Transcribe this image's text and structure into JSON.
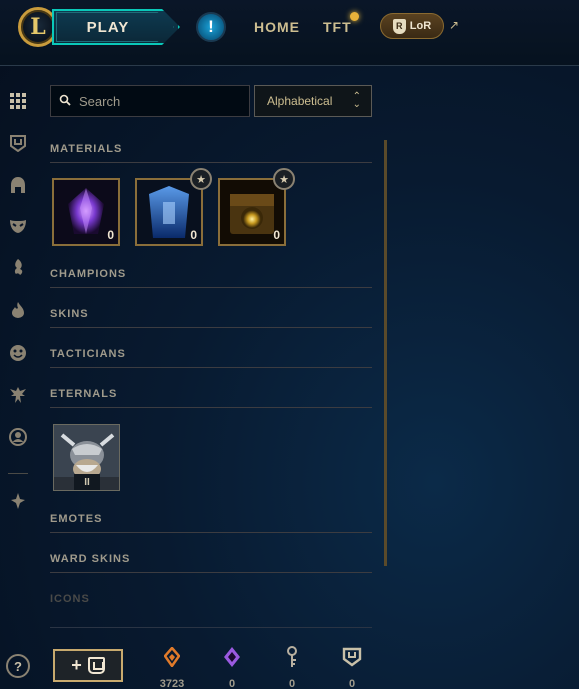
{
  "topbar": {
    "logo_letter": "L",
    "play_label": "PLAY",
    "alert_icon": "!",
    "home_label": "HOME",
    "tft_label": "TFT",
    "lor_label": "LoR",
    "lor_badge": "R",
    "external_glyph": "↗"
  },
  "rail": {
    "items": [
      {
        "icon": "grid-icon"
      },
      {
        "icon": "chest-icon"
      },
      {
        "icon": "helmet-icon"
      },
      {
        "icon": "mask-icon"
      },
      {
        "icon": "ward-icon"
      },
      {
        "icon": "flame-icon"
      },
      {
        "icon": "emote-icon"
      },
      {
        "icon": "tactician-icon"
      },
      {
        "icon": "profile-icon"
      },
      {
        "icon": "crafting-icon"
      }
    ],
    "help_label": "?"
  },
  "search": {
    "placeholder": "Search",
    "sort_value": "Alphabetical"
  },
  "sections": {
    "materials": "MATERIALS",
    "champions": "CHAMPIONS",
    "skins": "SKINS",
    "tacticians": "TACTICIANS",
    "eternals": "ETERNALS",
    "emotes": "EMOTES",
    "ward_skins": "WARD SKINS",
    "icons": "ICONS"
  },
  "materials": [
    {
      "name": "gemstone",
      "count": "0",
      "featured": false
    },
    {
      "name": "blue-capsule",
      "count": "0",
      "featured": true
    },
    {
      "name": "golden-chest",
      "count": "0",
      "featured": true
    }
  ],
  "eternals": {
    "series_label": "II"
  },
  "bottom": {
    "craft_label": "+",
    "currencies": [
      {
        "icon": "orange-essence-icon",
        "value": "3723",
        "color": "#e07a2a"
      },
      {
        "icon": "mythic-essence-icon",
        "value": "0",
        "color": "#9a5ae0"
      },
      {
        "icon": "key-icon",
        "value": "0",
        "color": "#b8b0a0"
      },
      {
        "icon": "chest-icon",
        "value": "0",
        "color": "#c8c0a8"
      }
    ]
  },
  "colors": {
    "gold": "#c8aa6e",
    "teal": "#0ac8b9",
    "background": "#081a30"
  }
}
